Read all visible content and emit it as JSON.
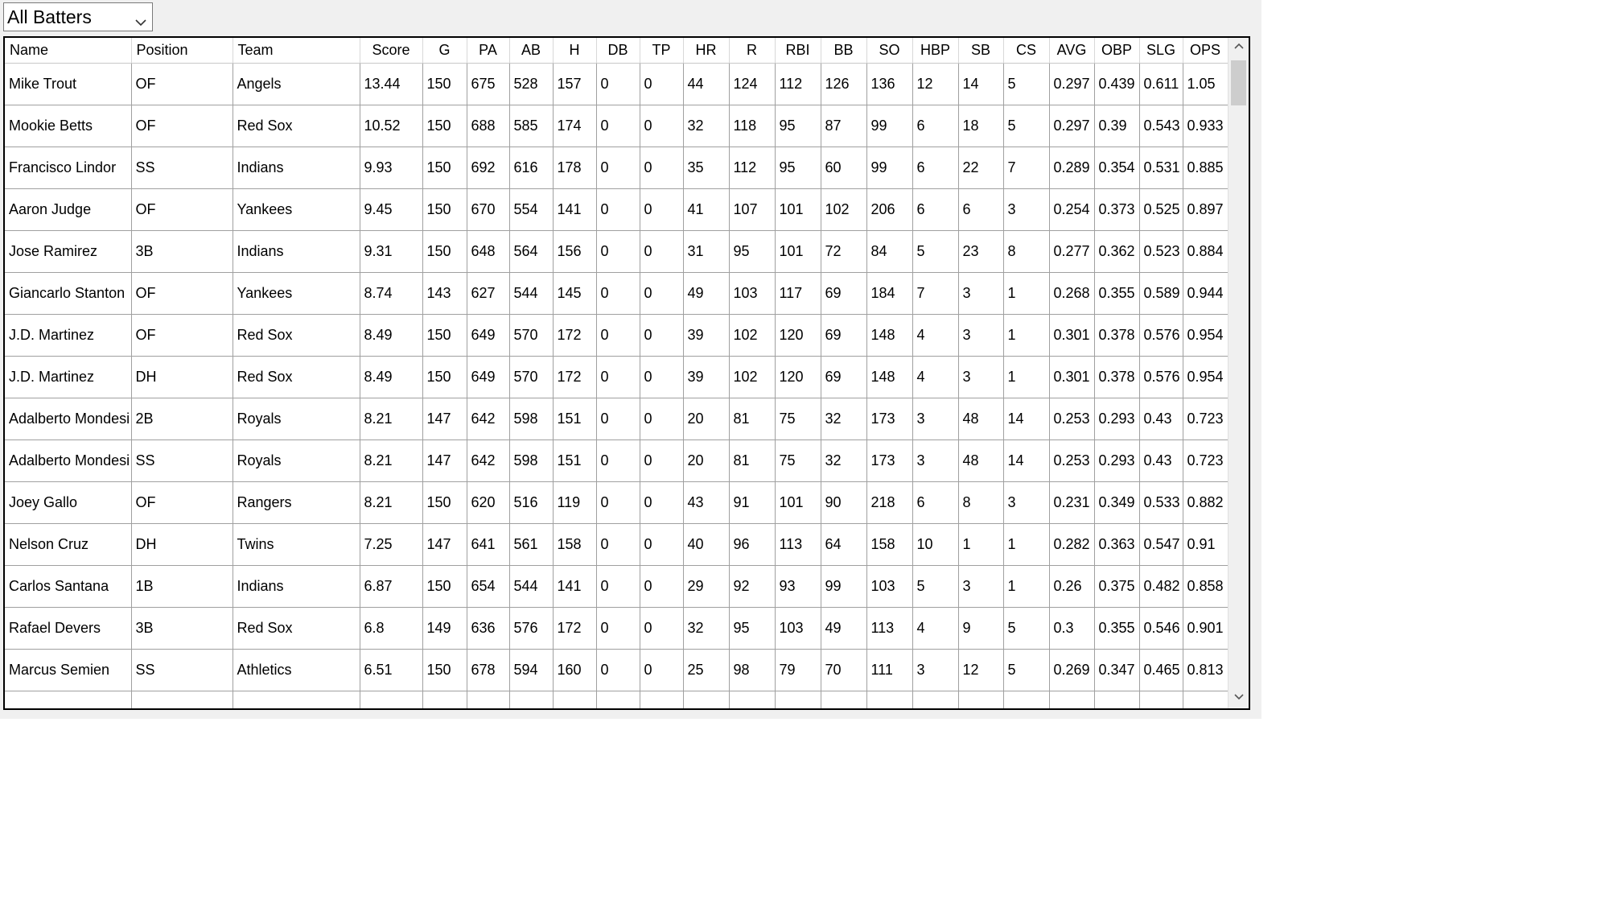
{
  "filter": {
    "selected": "All Batters",
    "icon": "chevron-down-icon"
  },
  "table": {
    "columns": [
      "Name",
      "Position",
      "Team",
      "Score",
      "G",
      "PA",
      "AB",
      "H",
      "DB",
      "TP",
      "HR",
      "R",
      "RBI",
      "BB",
      "SO",
      "HBP",
      "SB",
      "CS",
      "AVG",
      "OBP",
      "SLG",
      "OPS"
    ],
    "rows": [
      [
        "Mike Trout",
        "OF",
        "Angels",
        "13.44",
        "150",
        "675",
        "528",
        "157",
        "0",
        "0",
        "44",
        "124",
        "112",
        "126",
        "136",
        "12",
        "14",
        "5",
        "0.297",
        "0.439",
        "0.611",
        "1.05"
      ],
      [
        "Mookie Betts",
        "OF",
        "Red Sox",
        "10.52",
        "150",
        "688",
        "585",
        "174",
        "0",
        "0",
        "32",
        "118",
        "95",
        "87",
        "99",
        "6",
        "18",
        "5",
        "0.297",
        "0.39",
        "0.543",
        "0.933"
      ],
      [
        "Francisco Lindor",
        "SS",
        "Indians",
        "9.93",
        "150",
        "692",
        "616",
        "178",
        "0",
        "0",
        "35",
        "112",
        "95",
        "60",
        "99",
        "6",
        "22",
        "7",
        "0.289",
        "0.354",
        "0.531",
        "0.885"
      ],
      [
        "Aaron Judge",
        "OF",
        "Yankees",
        "9.45",
        "150",
        "670",
        "554",
        "141",
        "0",
        "0",
        "41",
        "107",
        "101",
        "102",
        "206",
        "6",
        "6",
        "3",
        "0.254",
        "0.373",
        "0.525",
        "0.897"
      ],
      [
        "Jose Ramirez",
        "3B",
        "Indians",
        "9.31",
        "150",
        "648",
        "564",
        "156",
        "0",
        "0",
        "31",
        "95",
        "101",
        "72",
        "84",
        "5",
        "23",
        "8",
        "0.277",
        "0.362",
        "0.523",
        "0.884"
      ],
      [
        "Giancarlo Stanton",
        "OF",
        "Yankees",
        "8.74",
        "143",
        "627",
        "544",
        "145",
        "0",
        "0",
        "49",
        "103",
        "117",
        "69",
        "184",
        "7",
        "3",
        "1",
        "0.268",
        "0.355",
        "0.589",
        "0.944"
      ],
      [
        "J.D. Martinez",
        "OF",
        "Red Sox",
        "8.49",
        "150",
        "649",
        "570",
        "172",
        "0",
        "0",
        "39",
        "102",
        "120",
        "69",
        "148",
        "4",
        "3",
        "1",
        "0.301",
        "0.378",
        "0.576",
        "0.954"
      ],
      [
        "J.D. Martinez",
        "DH",
        "Red Sox",
        "8.49",
        "150",
        "649",
        "570",
        "172",
        "0",
        "0",
        "39",
        "102",
        "120",
        "69",
        "148",
        "4",
        "3",
        "1",
        "0.301",
        "0.378",
        "0.576",
        "0.954"
      ],
      [
        "Adalberto Mondesi",
        "2B",
        "Royals",
        "8.21",
        "147",
        "642",
        "598",
        "151",
        "0",
        "0",
        "20",
        "81",
        "75",
        "32",
        "173",
        "3",
        "48",
        "14",
        "0.253",
        "0.293",
        "0.43",
        "0.723"
      ],
      [
        "Adalberto Mondesi",
        "SS",
        "Royals",
        "8.21",
        "147",
        "642",
        "598",
        "151",
        "0",
        "0",
        "20",
        "81",
        "75",
        "32",
        "173",
        "3",
        "48",
        "14",
        "0.253",
        "0.293",
        "0.43",
        "0.723"
      ],
      [
        "Joey Gallo",
        "OF",
        "Rangers",
        "8.21",
        "150",
        "620",
        "516",
        "119",
        "0",
        "0",
        "43",
        "91",
        "101",
        "90",
        "218",
        "6",
        "8",
        "3",
        "0.231",
        "0.349",
        "0.533",
        "0.882"
      ],
      [
        "Nelson Cruz",
        "DH",
        "Twins",
        "7.25",
        "147",
        "641",
        "561",
        "158",
        "0",
        "0",
        "40",
        "96",
        "113",
        "64",
        "158",
        "10",
        "1",
        "1",
        "0.282",
        "0.363",
        "0.547",
        "0.91"
      ],
      [
        "Carlos Santana",
        "1B",
        "Indians",
        "6.87",
        "150",
        "654",
        "544",
        "141",
        "0",
        "0",
        "29",
        "92",
        "93",
        "99",
        "103",
        "5",
        "3",
        "1",
        "0.26",
        "0.375",
        "0.482",
        "0.858"
      ],
      [
        "Rafael Devers",
        "3B",
        "Red Sox",
        "6.8",
        "149",
        "636",
        "576",
        "172",
        "0",
        "0",
        "32",
        "95",
        "103",
        "49",
        "113",
        "4",
        "9",
        "5",
        "0.3",
        "0.355",
        "0.546",
        "0.901"
      ],
      [
        "Marcus Semien",
        "SS",
        "Athletics",
        "6.51",
        "150",
        "678",
        "594",
        "160",
        "0",
        "0",
        "25",
        "98",
        "79",
        "70",
        "111",
        "3",
        "12",
        "5",
        "0.269",
        "0.347",
        "0.465",
        "0.813"
      ]
    ]
  },
  "scrollbar": {
    "up_icon": "chevron-up-icon",
    "down_icon": "chevron-down-icon"
  }
}
